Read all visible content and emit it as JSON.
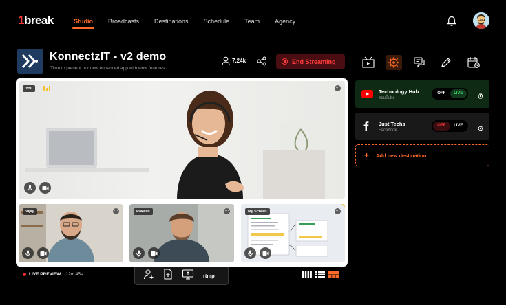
{
  "brand": {
    "logo_mark": "1",
    "logo_text": "break"
  },
  "nav": {
    "items": [
      {
        "label": "Studio",
        "active": true
      },
      {
        "label": "Broadcasts"
      },
      {
        "label": "Destinations"
      },
      {
        "label": "Schedule"
      },
      {
        "label": "Team"
      },
      {
        "label": "Agency"
      }
    ]
  },
  "header_icons": [
    "bell-icon",
    "user-avatar"
  ],
  "project": {
    "title": "KonnectzIT  - v2 demo",
    "subtitle": "Time to present our new enhanced app with wow features",
    "viewers": "7.24k",
    "end_label": "End Streaming"
  },
  "toolbar_icons": [
    "media-player-icon",
    "brand-settings-icon",
    "comments-icon",
    "edit-icon",
    "schedule-icon"
  ],
  "stage": {
    "main": {
      "tag": "You"
    },
    "tiles": [
      {
        "tag": "Vijay"
      },
      {
        "tag": "Rakesh"
      },
      {
        "tag": "My Screen"
      }
    ]
  },
  "footer": {
    "live_label": "LIVE PREVIEW",
    "live_time": "12m 45s",
    "rtmp_label": "rtmp"
  },
  "destinations": [
    {
      "name": "Technology Hub",
      "platform": "YouTube",
      "off": "OFF",
      "live": "LIVE",
      "state": "live"
    },
    {
      "name": "Just Techs",
      "platform": "Facebook",
      "off": "OFF",
      "live": "LIVE",
      "state": "off"
    }
  ],
  "add_destination": "Add new destination",
  "colors": {
    "accent": "#ff6a2a",
    "danger": "#ff3b3b",
    "live_green": "#3ddc6c"
  }
}
